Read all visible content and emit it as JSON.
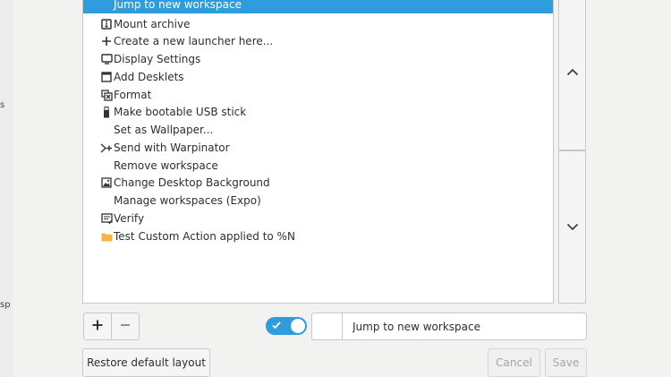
{
  "background": {
    "left_fragments": [
      "s",
      "sp"
    ]
  },
  "actions": {
    "items": [
      {
        "label": "Jump to new workspace",
        "icon": "none",
        "selected": true
      },
      {
        "label": "Mount archive",
        "icon": "archive-icon",
        "selected": false
      },
      {
        "label": "Create a new launcher here...",
        "icon": "plus-icon",
        "selected": false
      },
      {
        "label": "Display Settings",
        "icon": "display-icon",
        "selected": false
      },
      {
        "label": "Add Desklets",
        "icon": "desklet-icon",
        "selected": false
      },
      {
        "label": "Format",
        "icon": "format-icon",
        "selected": false
      },
      {
        "label": "Make bootable USB stick",
        "icon": "usb-icon",
        "selected": false
      },
      {
        "label": "Set as Wallpaper...",
        "icon": "none",
        "selected": false
      },
      {
        "label": "Send with Warpinator",
        "icon": "warpinator-icon",
        "selected": false
      },
      {
        "label": "Remove workspace",
        "icon": "none",
        "selected": false
      },
      {
        "label": "Change Desktop Background",
        "icon": "picture-icon",
        "selected": false
      },
      {
        "label": "Manage workspaces (Expo)",
        "icon": "none",
        "selected": false
      },
      {
        "label": "Verify",
        "icon": "verify-icon",
        "selected": false
      },
      {
        "label": "Test Custom Action applied to %N",
        "icon": "folder-icon",
        "selected": false
      }
    ]
  },
  "side_buttons": {
    "up_icon": "chevron-up-icon",
    "down_icon": "chevron-down-icon"
  },
  "controls": {
    "add_icon": "plus-icon",
    "remove_icon": "minus-icon",
    "toggle_on": true,
    "name_value": "Jump to new workspace"
  },
  "footer": {
    "restore_label": "Restore default layout",
    "cancel_label": "Cancel",
    "save_label": "Save"
  },
  "colors": {
    "accent": "#2f9cde",
    "folder": "#f6b53c"
  }
}
